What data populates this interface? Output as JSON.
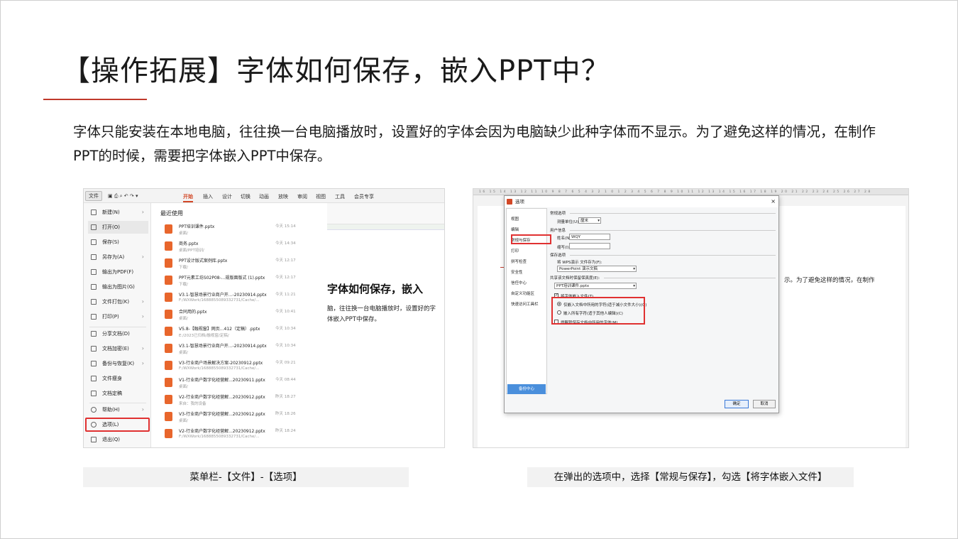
{
  "title": "【操作拓展】字体如何保存，嵌入PPT中？",
  "description": "字体只能安装在本地电脑，往往换一台电脑播放时，设置好的字体会因为电脑缺少此种字体而不显示。为了避免这样的情况，在制作PPT的时候，需要把字体嵌入PPT中保存。",
  "shot1": {
    "file_button": "文件",
    "tabs": [
      "开始",
      "插入",
      "设计",
      "切换",
      "动画",
      "放映",
      "审阅",
      "视图",
      "工具",
      "会员专享"
    ],
    "menu": [
      "新建(N)",
      "打开(O)",
      "保存(S)",
      "另存为(A)",
      "输出为PDF(F)",
      "输出为图片(G)",
      "文件打包(K)",
      "打印(P)",
      "分享文档(D)",
      "文档加密(E)",
      "备份与恢复(K)",
      "文件瘦身",
      "文档定稿",
      "帮助(H)",
      "选项(L)",
      "退出(Q)"
    ],
    "recent_header": "最近使用",
    "recent": [
      {
        "name": "PPT培训课件.pptx",
        "path": "桌面/",
        "time": "今天 15:14"
      },
      {
        "name": "商务.pptx",
        "path": "桌面/PPT培训/",
        "time": "今天 14:34"
      },
      {
        "name": "PPT设计版式案例库.pptx",
        "path": "下载/",
        "time": "今天 12:17"
      },
      {
        "name": "PPT元素工坊S02P08-...规版面版式 (1).pptx",
        "path": "下载/",
        "time": "今天 12:17"
      },
      {
        "name": "V3.1-智慧场景行业商户开...-20230914.pptx",
        "path": "F:/WXWork/1688855089332731/Cache/...",
        "time": "今天 11:21"
      },
      {
        "name": "合同用的.pptx",
        "path": "桌面/",
        "time": "今天 10:41"
      },
      {
        "name": "V5.8-【融视窗】网页...412（定稿）.pptx",
        "path": "E:/2023已归档/融视窗/定稿/",
        "time": "今天 10:34"
      },
      {
        "name": "V3.1-智慧场景行业商户开...-20230914.pptx",
        "path": "桌面/",
        "time": "今天 10:34"
      },
      {
        "name": "V3-行业商户场景解决方案-20230912.pptx",
        "path": "F:/WXWork/1688855089332731/Cache/...",
        "time": "今天 09:21"
      },
      {
        "name": "V1-行业商户数字化经营解...20230911.pptx",
        "path": "桌面/",
        "time": "今天 08:44"
      },
      {
        "name": "V2-行业商户数字化经营解...20230912.pptx",
        "path": "来自：我的设备",
        "time": "昨天 18:27"
      },
      {
        "name": "V3-行业商户数字化经营解...20230912.pptx",
        "path": "桌面/",
        "time": "昨天 18:26"
      },
      {
        "name": "V2-行业商户数字化经营解...20230912.pptx",
        "path": "F:/WXWork/1688855089332731/Cache/...",
        "time": "昨天 18:24"
      }
    ],
    "right_title": "字体如何保存，嵌入",
    "right_line1": "脑，往往换一台电脑播放时，设置好的字",
    "right_line2": "体嵌入PPT中保存。"
  },
  "shot2": {
    "dialog_title": "选项",
    "nav": [
      "视图",
      "编辑",
      "常规与保存",
      "打印",
      "拼写检查",
      "安全性",
      "信任中心",
      "自定义功能区",
      "快速访问工具栏"
    ],
    "backup_button": "备份中心",
    "section_general": "常规选项",
    "unit_label": "测量单位(U):",
    "unit_value": "厘米",
    "section_user": "用户信息",
    "name_label": "姓名(N):",
    "name_value": "WQY",
    "initials_label": "缩写(I):",
    "section_save": "保存选项",
    "save_as_label": "将 WPS演示 文件存为(F):",
    "save_as_value": "PowerPoint 演示文稿",
    "fidelity_label": "共享该文档时保留保真度(E):",
    "fidelity_value": "PPT培训课件.pptx",
    "embed_fonts": "将字体嵌入文件(T)",
    "embed_used": "仅嵌入文档中所用的字符(适于减小文件大小)(O)",
    "embed_all": "嵌入所有字符(适于其他人编辑)(C)",
    "remind": "提醒我保存文档中所用的字体(M)",
    "ok": "确定",
    "cancel": "取消",
    "bg_text": "示。为了避免这样的情况，在制作"
  },
  "captions": {
    "left": "菜单栏-【文件】-【选项】",
    "right": "在弹出的选项中，选择【常规与保存】，勾选【将字体嵌入文件】"
  }
}
